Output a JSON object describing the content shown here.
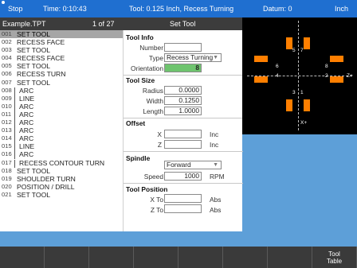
{
  "status_bar": {
    "mode": "Stop",
    "time": "Time: 0:10:43",
    "tool": "Tool: 0.125 Inch, Recess Turning",
    "datum": "Datum: 0",
    "units": "Inch"
  },
  "header": {
    "file": "Example.TPT",
    "position": "1 of 27",
    "panel_title": "Set Tool"
  },
  "program": [
    {
      "num": "001",
      "text": "SET TOOL",
      "selected": true
    },
    {
      "num": "002",
      "text": "RECESS FACE"
    },
    {
      "num": "003",
      "text": "SET TOOL"
    },
    {
      "num": "004",
      "text": "RECESS FACE"
    },
    {
      "num": "005",
      "text": "SET TOOL"
    },
    {
      "num": "006",
      "text": "RECESS TURN"
    },
    {
      "num": "007",
      "text": "SET TOOL"
    },
    {
      "num": "008",
      "text": "ARC",
      "bracket": true
    },
    {
      "num": "009",
      "text": "LINE",
      "bracket": true
    },
    {
      "num": "010",
      "text": "ARC",
      "bracket": true
    },
    {
      "num": "011",
      "text": "ARC",
      "bracket": true
    },
    {
      "num": "012",
      "text": "ARC",
      "bracket": true
    },
    {
      "num": "013",
      "text": "ARC",
      "bracket": true
    },
    {
      "num": "014",
      "text": "ARC",
      "bracket": true
    },
    {
      "num": "015",
      "text": "LINE",
      "bracket": true
    },
    {
      "num": "016",
      "text": "ARC",
      "bracket": true
    },
    {
      "num": "017",
      "text": "RECESS CONTOUR TURN",
      "bracket": true
    },
    {
      "num": "018",
      "text": "SET TOOL"
    },
    {
      "num": "019",
      "text": "SHOULDER TURN"
    },
    {
      "num": "020",
      "text": "POSITION / DRILL"
    },
    {
      "num": "021",
      "text": "SET TOOL"
    }
  ],
  "form": {
    "tool_info": {
      "title": "Tool Info",
      "number_label": "Number",
      "number_value": "",
      "type_label": "Type",
      "type_value": "Recess Turning",
      "orientation_label": "Orientation",
      "orientation_value": "8"
    },
    "tool_size": {
      "title": "Tool Size",
      "radius_label": "Radius",
      "radius_value": "0.0000",
      "width_label": "Width",
      "width_value": "0.1250",
      "length_label": "Length",
      "length_value": "1.0000"
    },
    "offset": {
      "title": "Offset",
      "x_label": "X",
      "x_value": "",
      "x_unit": "Inc",
      "z_label": "Z",
      "z_value": "",
      "z_unit": "Inc"
    },
    "spindle": {
      "title": "Spindle",
      "direction_value": "Forward",
      "speed_label": "Speed",
      "speed_value": "1000",
      "speed_unit": "RPM"
    },
    "tool_position": {
      "title": "Tool Position",
      "xto_label": "X To",
      "xto_value": "",
      "xto_unit": "Abs",
      "zto_label": "Z To",
      "zto_value": "",
      "zto_unit": "Abs"
    }
  },
  "graphic": {
    "labels": [
      "5",
      "7",
      "6",
      "8",
      "4",
      "2",
      "Z+",
      "3",
      "1",
      "X+"
    ],
    "accent_color": "#ff7f00"
  },
  "softkeys": [
    "",
    "",
    "",
    "",
    "",
    "",
    "",
    "Tool\nTable"
  ],
  "colors": {
    "status_bg": "#1f6fd0",
    "field_highlight": "#6ec46e",
    "selected_row": "#a6a6a6"
  }
}
